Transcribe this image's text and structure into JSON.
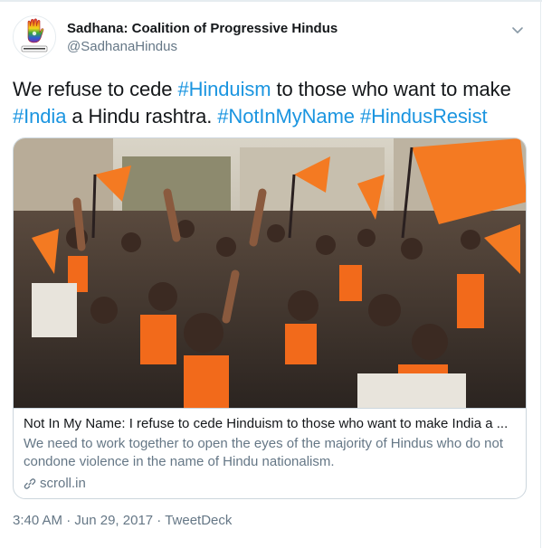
{
  "user": {
    "display_name": "Sadhana: Coalition of Progressive Hindus",
    "handle": "@SadhanaHindus"
  },
  "tweet": {
    "segments": [
      {
        "text": "We refuse to cede ",
        "type": "text"
      },
      {
        "text": "#Hinduism",
        "type": "hashtag"
      },
      {
        "text": " to those who want to make ",
        "type": "text"
      },
      {
        "text": "#India",
        "type": "hashtag"
      },
      {
        "text": " a Hindu rashtra. ",
        "type": "text"
      },
      {
        "text": "#NotInMyName",
        "type": "hashtag"
      },
      {
        "text": " ",
        "type": "text"
      },
      {
        "text": "#HindusResist",
        "type": "hashtag"
      }
    ]
  },
  "card": {
    "title": "Not In My Name: I refuse to cede Hinduism to those who want to make India a ...",
    "description": "We need to work together to open the eyes of the majority of Hindus who do not condone violence in the name of Hindu nationalism.",
    "domain": "scroll.in"
  },
  "meta": {
    "time": "3:40 AM",
    "separator1": " · ",
    "date": "Jun 29, 2017",
    "separator2": " · ",
    "source": "TweetDeck"
  },
  "colors": {
    "hashtag": "#1b95e0",
    "saffron": "#f26a1b",
    "secondary_text": "#657786"
  }
}
